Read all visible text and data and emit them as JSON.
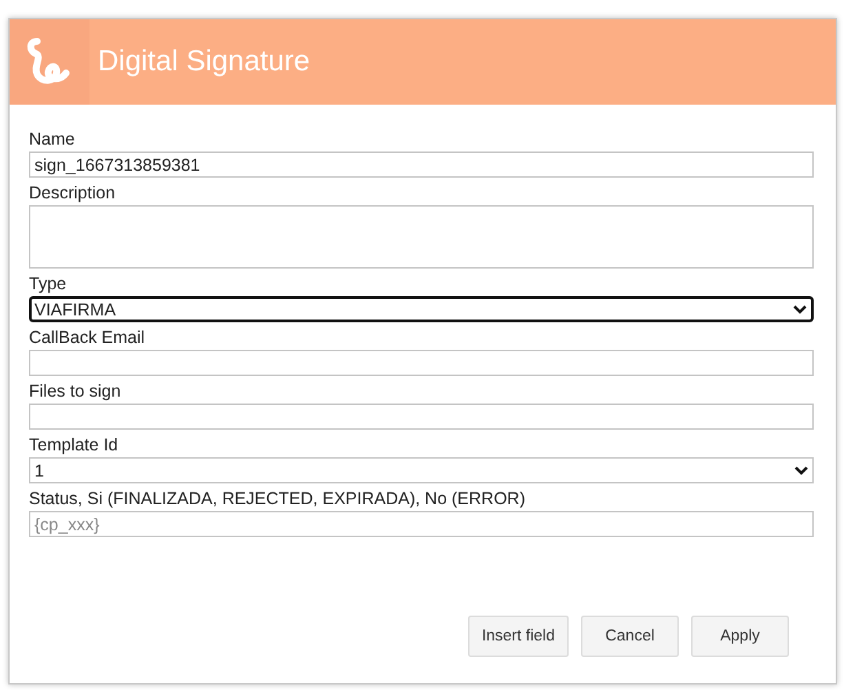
{
  "dialog": {
    "title": "Digital Signature"
  },
  "fields": [
    {
      "kind": "text",
      "label": "Name",
      "value": "sign_1667313859381",
      "focused": false
    },
    {
      "kind": "textarea",
      "label": "Description",
      "focused": false
    },
    {
      "kind": "select",
      "label": "Type",
      "value": "VIAFIRMA",
      "focused": true
    },
    {
      "kind": "text",
      "label": "CallBack Email",
      "focused": false
    },
    {
      "kind": "text",
      "label": "Files to sign",
      "focused": false
    },
    {
      "kind": "select",
      "label": "Template Id",
      "value": "1",
      "focused": false
    },
    {
      "kind": "text",
      "label": "Status, Si (FINALIZADA, REJECTED, EXPIRADA), No (ERROR)",
      "placeholder": "{cp_xxx}",
      "focused": false
    }
  ],
  "buttons": [
    "Insert field",
    "Cancel",
    "Apply"
  ]
}
